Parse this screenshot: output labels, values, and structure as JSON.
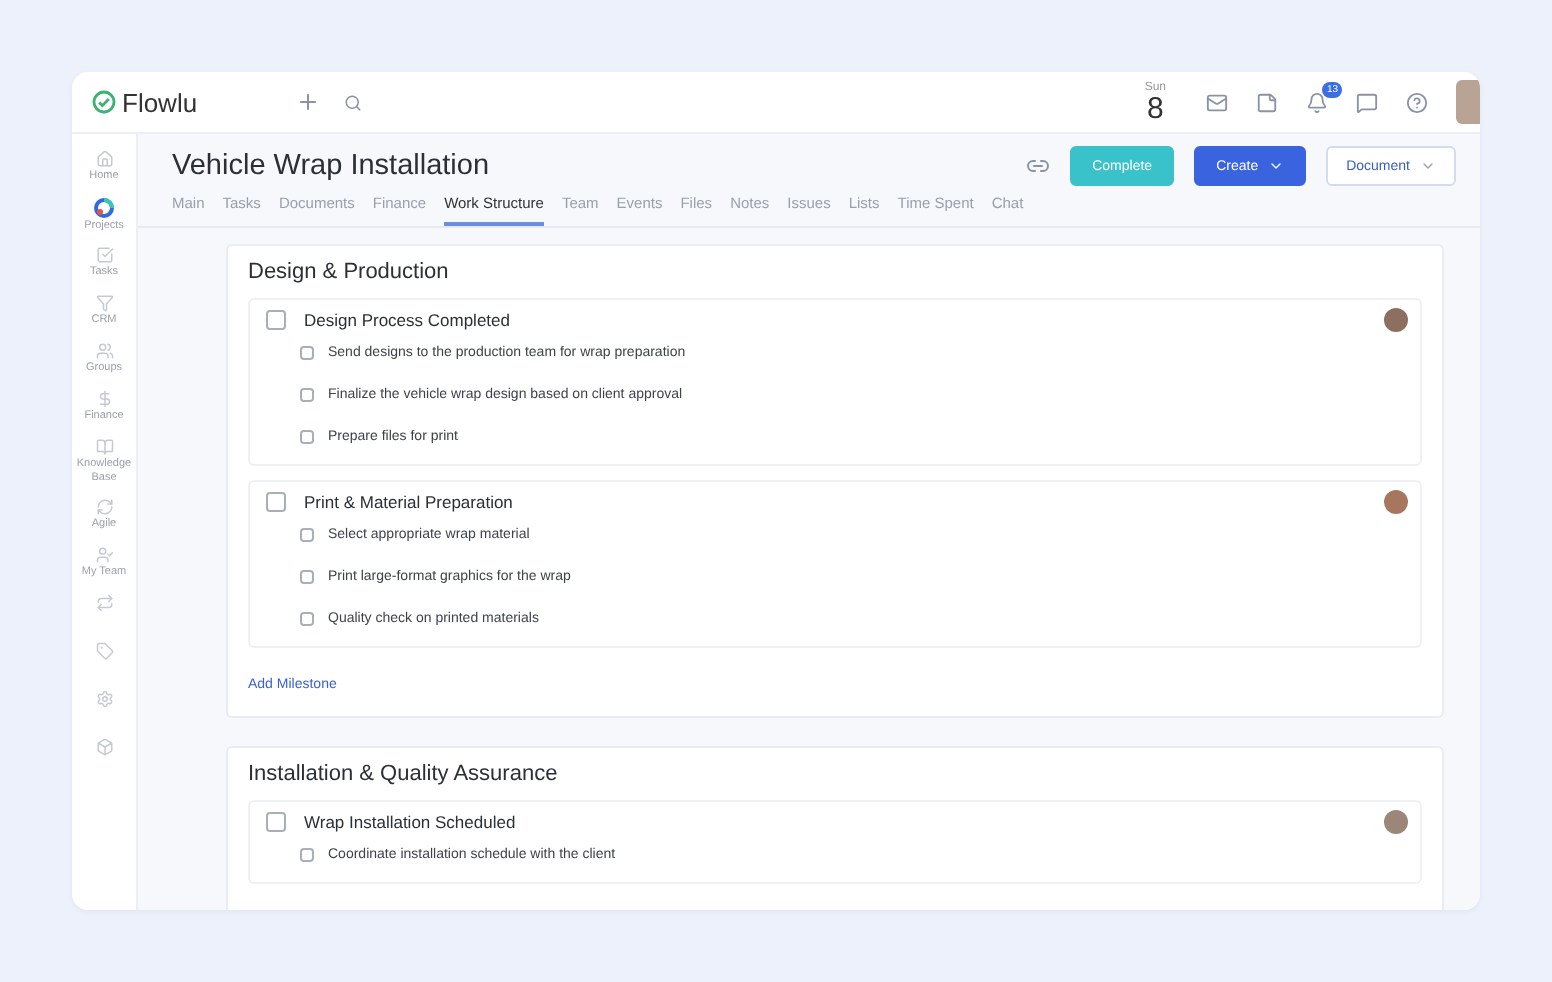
{
  "app": {
    "logo": "Flowlu",
    "date": {
      "weekday": "Sun",
      "day": "8"
    },
    "notifications": "13"
  },
  "sidebar": {
    "items": [
      {
        "label": "Home",
        "selected": false
      },
      {
        "label": "Projects",
        "selected": true
      },
      {
        "label": "Tasks",
        "selected": false
      },
      {
        "label": "CRM",
        "selected": false
      },
      {
        "label": "Groups",
        "selected": false
      },
      {
        "label": "Finance",
        "selected": false
      },
      {
        "label": "Knowledge Base",
        "selected": false
      },
      {
        "label": "Agile",
        "selected": false
      },
      {
        "label": "My Team",
        "selected": false
      },
      {
        "selected": false
      },
      {
        "selected": false
      },
      {
        "selected": false
      },
      {
        "selected": false
      }
    ]
  },
  "project": {
    "title": "Vehicle Wrap Installation",
    "buttons": {
      "complete": "Complete",
      "create": "Create",
      "document": "Document"
    },
    "tabs": [
      {
        "label": "Main",
        "selected": false
      },
      {
        "label": "Tasks",
        "selected": false
      },
      {
        "label": "Documents",
        "selected": false
      },
      {
        "label": "Finance",
        "selected": false
      },
      {
        "label": "Work Structure",
        "selected": true
      },
      {
        "label": "Team",
        "selected": false
      },
      {
        "label": "Events",
        "selected": false
      },
      {
        "label": "Files",
        "selected": false
      },
      {
        "label": "Notes",
        "selected": false
      },
      {
        "label": "Issues",
        "selected": false
      },
      {
        "label": "Lists",
        "selected": false
      },
      {
        "label": "Time Spent",
        "selected": false
      },
      {
        "label": "Chat",
        "selected": false
      }
    ]
  },
  "stages": [
    {
      "title": "Design & Production",
      "add_label": "Add Milestone",
      "milestones": [
        {
          "title": "Design Process Completed",
          "checked": false,
          "tasks": [
            {
              "label": "Send designs to the production team for wrap preparation",
              "checked": false
            },
            {
              "label": "Finalize the vehicle wrap design based on client approval",
              "checked": false
            },
            {
              "label": "Prepare files for print",
              "checked": false
            }
          ]
        },
        {
          "title": "Print & Material Preparation",
          "checked": false,
          "tasks": [
            {
              "label": "Select appropriate wrap material",
              "checked": false
            },
            {
              "label": "Print large-format graphics for the wrap",
              "checked": false
            },
            {
              "label": "Quality check on printed materials",
              "checked": false
            }
          ]
        }
      ]
    },
    {
      "title": "Installation & Quality Assurance",
      "milestones": [
        {
          "title": "Wrap Installation Scheduled",
          "checked": false,
          "tasks": [
            {
              "label": "Coordinate installation schedule with the client",
              "checked": false
            }
          ]
        }
      ]
    }
  ]
}
